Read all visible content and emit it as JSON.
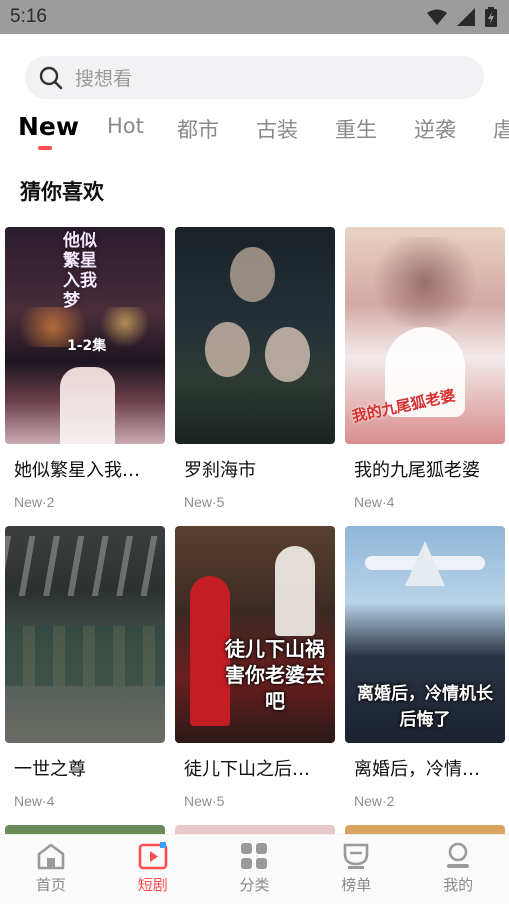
{
  "status_bar": {
    "time": "5:16"
  },
  "search": {
    "placeholder": "搜想看"
  },
  "tabs": [
    {
      "label": "New"
    },
    {
      "label": "Hot"
    },
    {
      "label": "都市"
    },
    {
      "label": "古装"
    },
    {
      "label": "重生"
    },
    {
      "label": "逆袭"
    },
    {
      "label": "虐"
    }
  ],
  "section": {
    "title": "猜你喜欢"
  },
  "cards": [
    {
      "title": "她似繁星入我…",
      "meta": "New·2",
      "poster_text": "他似繁星入我梦",
      "poster_sub": "1-2集"
    },
    {
      "title": "罗刹海市",
      "meta": "New·5"
    },
    {
      "title": "我的九尾狐老婆",
      "meta": "New·4",
      "poster_text": "我的九尾狐老婆"
    },
    {
      "title": "一世之尊",
      "meta": "New·4"
    },
    {
      "title": "徒儿下山之后…",
      "meta": "New·5",
      "poster_text": "徒儿下山祸害你老婆去吧"
    },
    {
      "title": "离婚后，冷情…",
      "meta": "New·2",
      "poster_text": "离婚后，冷情机长后悔了"
    }
  ],
  "bottom_nav": [
    {
      "label": "首页",
      "icon": "home-icon"
    },
    {
      "label": "短剧",
      "icon": "play-icon"
    },
    {
      "label": "分类",
      "icon": "grid-icon"
    },
    {
      "label": "榜单",
      "icon": "trophy-icon"
    },
    {
      "label": "我的",
      "icon": "user-icon"
    }
  ],
  "colors": {
    "accent": "#ff4d4f",
    "text": "#111111",
    "muted": "#8e8e8e"
  }
}
